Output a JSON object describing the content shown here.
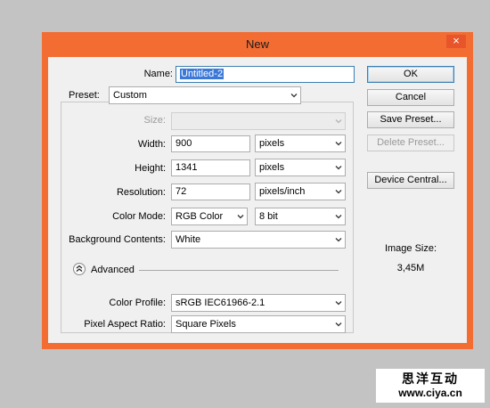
{
  "window": {
    "title": "New",
    "close_glyph": "×"
  },
  "name": {
    "label": "Name:",
    "value": "Untitled-2"
  },
  "preset": {
    "label": "Preset:",
    "value": "Custom"
  },
  "size": {
    "label": "Size:",
    "value": ""
  },
  "width": {
    "label": "Width:",
    "value": "900",
    "unit": "pixels"
  },
  "height": {
    "label": "Height:",
    "value": "1341",
    "unit": "pixels"
  },
  "resolution": {
    "label": "Resolution:",
    "value": "72",
    "unit": "pixels/inch"
  },
  "color_mode": {
    "label": "Color Mode:",
    "value": "RGB Color",
    "depth": "8 bit"
  },
  "background": {
    "label": "Background Contents:",
    "value": "White"
  },
  "advanced": {
    "label": "Advanced",
    "expanded": true
  },
  "color_profile": {
    "label": "Color Profile:",
    "value": "sRGB IEC61966-2.1"
  },
  "pixel_aspect": {
    "label": "Pixel Aspect Ratio:",
    "value": "Square Pixels"
  },
  "buttons": {
    "ok": "OK",
    "cancel": "Cancel",
    "save_preset": "Save Preset...",
    "delete_preset": "Delete Preset...",
    "device_central": "Device Central..."
  },
  "image_size": {
    "label": "Image Size:",
    "value": "3,45M"
  },
  "watermark": {
    "line1": "思洋互动",
    "line2": "www.ciya.cn"
  },
  "colors": {
    "title_bar": "#f36d33",
    "dialog_bg": "#f0f0f0",
    "selection": "#3b78d8"
  },
  "icons": {
    "dropdown": "chevron-down-icon",
    "advanced": "collapse-chevron-icon",
    "close": "close-icon"
  }
}
